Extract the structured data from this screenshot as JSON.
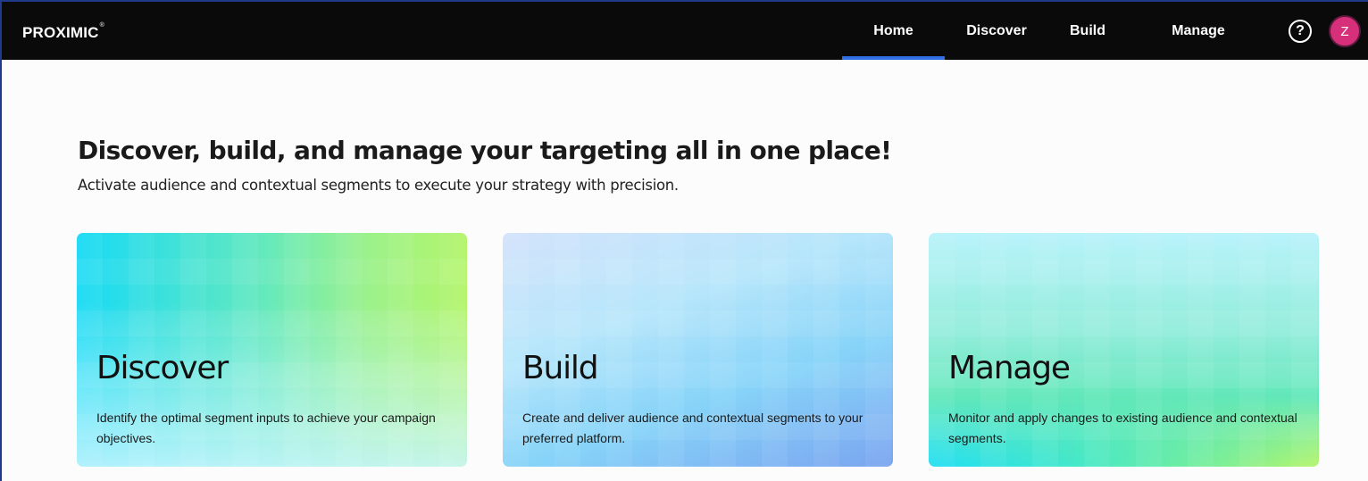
{
  "header": {
    "logo_text": "PROXIMIC",
    "logo_mark": "®",
    "nav": [
      {
        "label": "Home",
        "active": true
      },
      {
        "label": "Discover",
        "active": false
      },
      {
        "label": "Build",
        "active": false
      },
      {
        "label": "Manage",
        "active": false
      }
    ],
    "help_icon": "question-circle-icon",
    "help_glyph": "?",
    "avatar_initial": "Z",
    "avatar_color": "#d6307a",
    "active_tab_color": "#2f6fe6"
  },
  "main": {
    "title": "Discover, build, and manage your targeting all in one place!",
    "subtitle": "Activate audience and contextual segments to execute your strategy with precision.",
    "cards": [
      {
        "title": "Discover",
        "description": "Identify the optimal segment inputs to achieve your campaign objectives."
      },
      {
        "title": "Build",
        "description": "Create and deliver audience and contextual segments to your preferred platform."
      },
      {
        "title": "Manage",
        "description": "Monitor and apply changes to existing audience and contextual segments."
      }
    ]
  }
}
